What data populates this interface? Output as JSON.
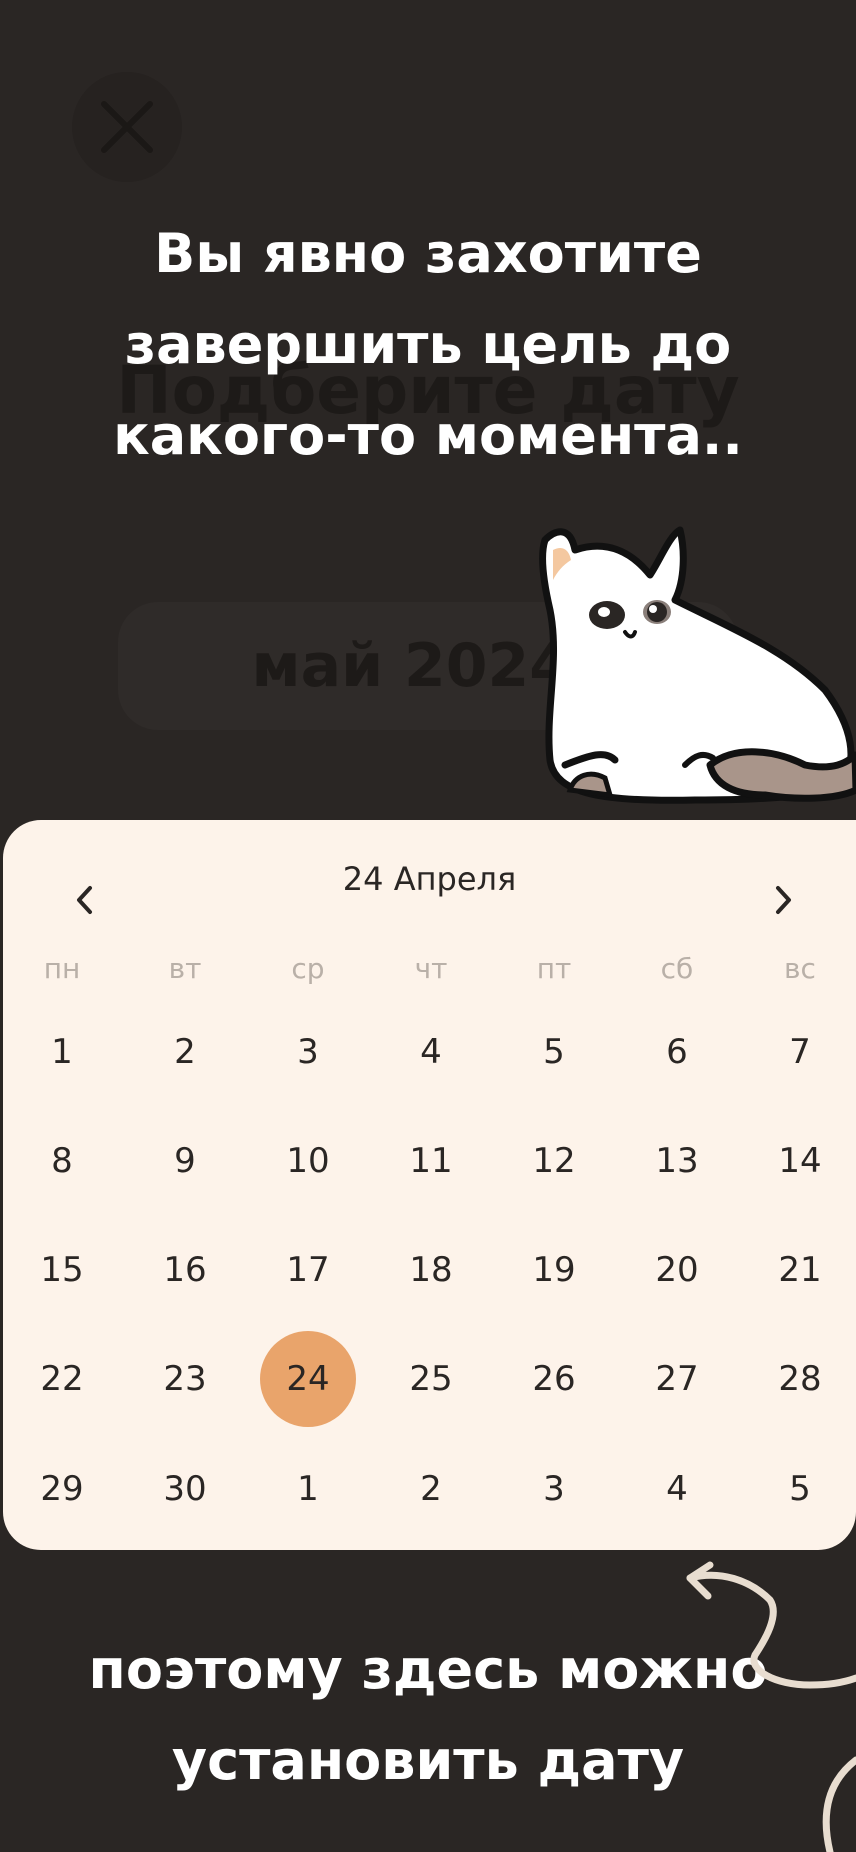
{
  "background_title": "Подберите дату",
  "month_pill_text": "май 2024 го",
  "overlay_top": [
    "Вы явно захотите",
    "завершить цель до",
    "какого-то момента.."
  ],
  "overlay_bottom": [
    "поэтому здесь можно",
    "установить дату"
  ],
  "calendar": {
    "title": "24 Апреля",
    "weekdays": [
      "пн",
      "вт",
      "ср",
      "чт",
      "пт",
      "сб",
      "вс"
    ],
    "days": [
      [
        "1",
        "2",
        "3",
        "4",
        "5",
        "6",
        "7"
      ],
      [
        "8",
        "9",
        "10",
        "11",
        "12",
        "13",
        "14"
      ],
      [
        "15",
        "16",
        "17",
        "18",
        "19",
        "20",
        "21"
      ],
      [
        "22",
        "23",
        "24",
        "25",
        "26",
        "27",
        "28"
      ],
      [
        "29",
        "30",
        "1",
        "2",
        "3",
        "4",
        "5"
      ]
    ],
    "selected_day": "24"
  },
  "colors": {
    "background": "#2a2624",
    "calendar_bg": "#fdf3ea",
    "accent": "#e9a46b",
    "text_light": "#ffffff",
    "weekday_gray": "#b9b0a8"
  },
  "icons": {
    "close": "close-icon",
    "prev": "chevron-left-icon",
    "next": "chevron-right-icon",
    "mascot": "cat-illustration",
    "arrow": "curved-arrow-icon"
  }
}
